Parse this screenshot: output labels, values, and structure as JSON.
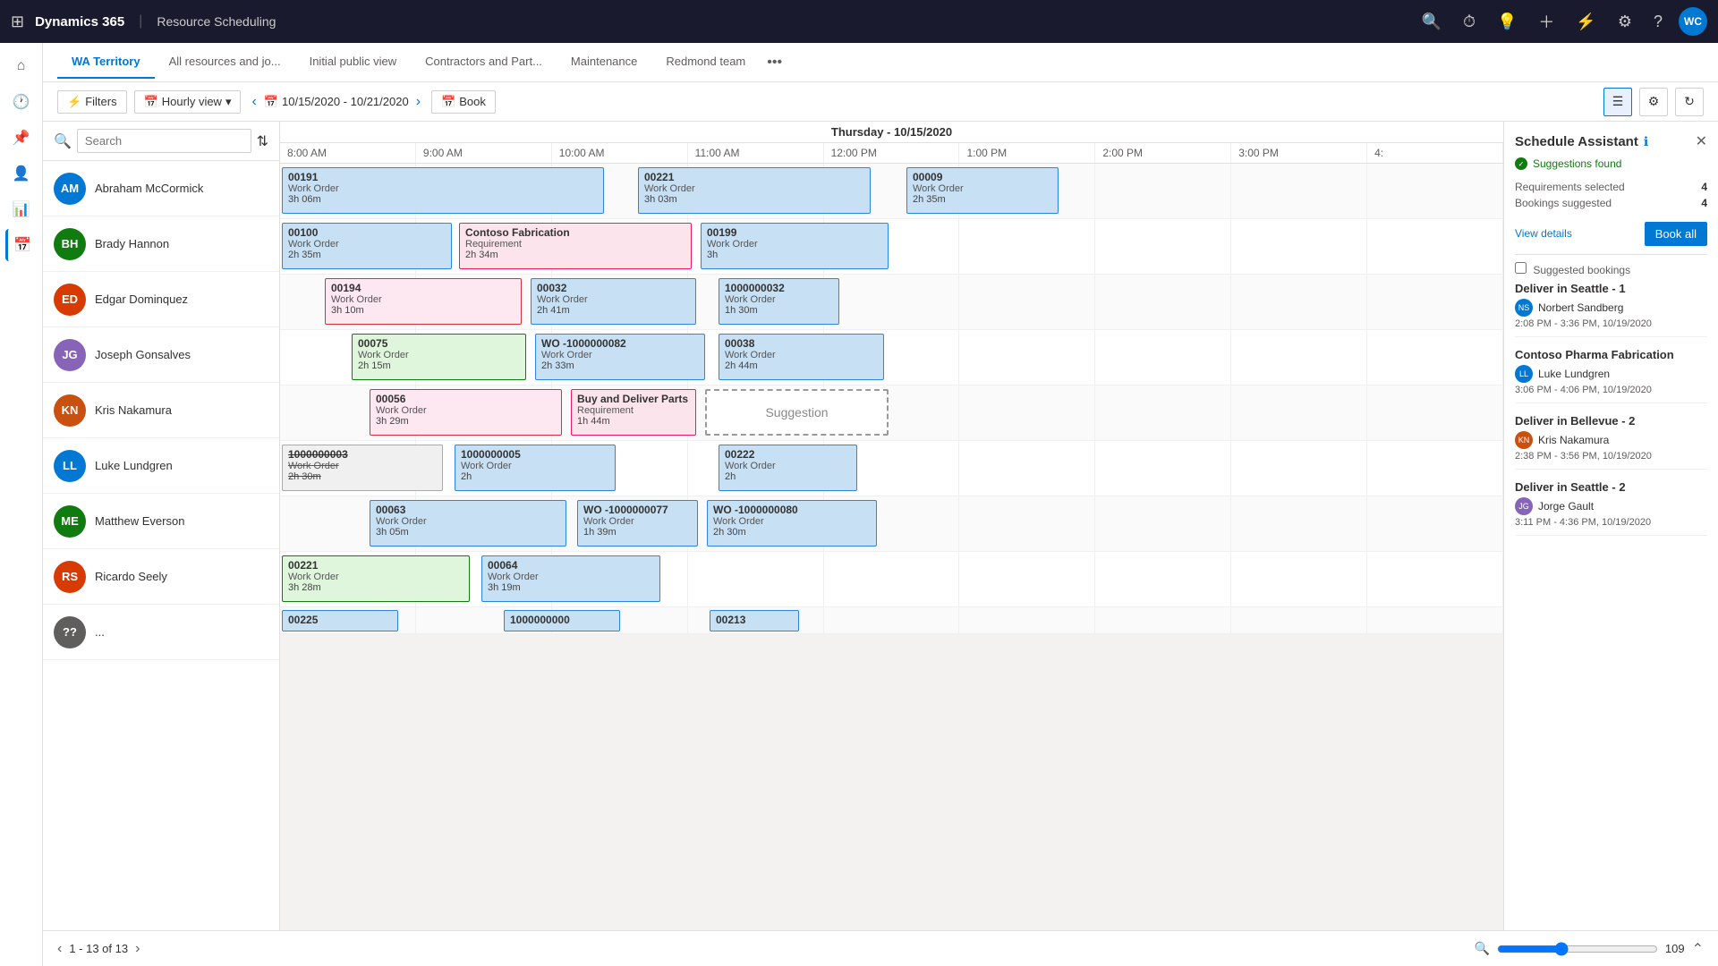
{
  "app": {
    "title": "Dynamics 365",
    "separator": "|",
    "module": "Resource Scheduling",
    "user_initials": "WC"
  },
  "tabs": [
    {
      "id": "wa-territory",
      "label": "WA Territory",
      "active": true
    },
    {
      "id": "all-resources",
      "label": "All resources and jo...",
      "active": false
    },
    {
      "id": "initial-public",
      "label": "Initial public view",
      "active": false
    },
    {
      "id": "contractors",
      "label": "Contractors and Part...",
      "active": false
    },
    {
      "id": "maintenance",
      "label": "Maintenance",
      "active": false
    },
    {
      "id": "redmond-team",
      "label": "Redmond team",
      "active": false
    }
  ],
  "toolbar": {
    "filters_label": "Filters",
    "hourly_view_label": "Hourly view",
    "date_range": "10/15/2020 - 10/21/2020",
    "book_label": "Book"
  },
  "search": {
    "placeholder": "Search"
  },
  "timeline": {
    "date_header": "Thursday - 10/15/2020",
    "hours": [
      "8:00 AM",
      "9:00 AM",
      "10:00 AM",
      "11:00 AM",
      "12:00 PM",
      "1:00 PM",
      "2:00 PM",
      "3:00 PM",
      "4:"
    ]
  },
  "resources": [
    {
      "id": "abraham",
      "name": "Abraham McCormick",
      "initials": "AM",
      "color": "#0078d4"
    },
    {
      "id": "brady",
      "name": "Brady Hannon",
      "initials": "BH",
      "color": "#107c10"
    },
    {
      "id": "edgar",
      "name": "Edgar Dominquez",
      "initials": "ED",
      "color": "#d83b01"
    },
    {
      "id": "joseph",
      "name": "Joseph Gonsalves",
      "initials": "JG",
      "color": "#8764b8"
    },
    {
      "id": "kris",
      "name": "Kris Nakamura",
      "initials": "KN",
      "color": "#ca5010"
    },
    {
      "id": "luke",
      "name": "Luke Lundgren",
      "initials": "LL",
      "color": "#0078d4"
    },
    {
      "id": "matthew",
      "name": "Matthew Everson",
      "initials": "ME",
      "color": "#107c10"
    },
    {
      "id": "ricardo",
      "name": "Ricardo Seely",
      "initials": "RS",
      "color": "#d83b01"
    }
  ],
  "schedule_assistant": {
    "title": "Schedule Assistant",
    "status": "Suggestions found",
    "requirements_selected_label": "Requirements selected",
    "requirements_selected_value": "4",
    "bookings_suggested_label": "Bookings suggested",
    "bookings_suggested_value": "4",
    "view_details_label": "View details",
    "book_all_label": "Book all",
    "suggested_bookings_label": "Suggested bookings",
    "bookings": [
      {
        "title": "Deliver in Seattle - 1",
        "resource": "Norbert Sandberg",
        "resource_initials": "NS",
        "time": "2:08 PM - 3:36 PM, 10/19/2020"
      },
      {
        "title": "Contoso Pharma Fabrication",
        "resource": "Luke Lundgren",
        "resource_initials": "LL",
        "time": "3:06 PM - 4:06 PM, 10/19/2020"
      },
      {
        "title": "Deliver in Bellevue - 2",
        "resource": "Kris Nakamura",
        "resource_initials": "KN",
        "time": "2:38 PM - 3:56 PM, 10/19/2020"
      },
      {
        "title": "Deliver in Seattle - 2",
        "resource": "Jorge Gault",
        "resource_initials": "JG",
        "time": "3:11 PM - 4:36 PM, 10/19/2020"
      }
    ]
  },
  "pagination": {
    "current": "1 - 13 of 13"
  },
  "zoom": {
    "value": "109"
  }
}
